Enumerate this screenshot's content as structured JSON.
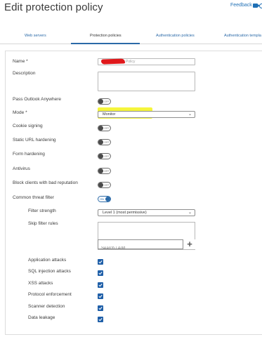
{
  "header": {
    "title": "Edit protection policy",
    "feedback": "Feedback",
    "icons": [
      "video-icon",
      "globe-icon"
    ]
  },
  "tabs": [
    {
      "label": "Web servers",
      "active": false
    },
    {
      "label": "Protection policies",
      "active": true
    },
    {
      "label": "Authentication policies",
      "active": false
    },
    {
      "label": "Authentication templa",
      "active": false
    }
  ],
  "form": {
    "name": {
      "label": "Name *",
      "value": "Policy",
      "redacted": true
    },
    "description": {
      "label": "Description",
      "value": ""
    },
    "pass_outlook_anywhere": {
      "label": "Pass Outlook Anywhere",
      "state": "OFF"
    },
    "mode": {
      "label": "Mode *",
      "value": "Monitor"
    },
    "cookie_signing": {
      "label": "Cookie signing",
      "state": "OFF"
    },
    "static_url_hardening": {
      "label": "Static URL hardening",
      "state": "OFF"
    },
    "form_hardening": {
      "label": "Form hardening",
      "state": "OFF"
    },
    "antivirus": {
      "label": "Antivirus",
      "state": "OFF"
    },
    "block_bad_reputation": {
      "label": "Block clients with bad reputation",
      "state": "OFF"
    },
    "common_threat_filter": {
      "label": "Common threat filter",
      "state": "ON"
    },
    "filter_strength": {
      "label": "Filter strength",
      "value": "Level 1 (most permissive)"
    },
    "skip_filter_rules": {
      "label": "Skip filter rules",
      "placeholder": "Search / Add"
    },
    "checks": [
      {
        "label": "Application attacks",
        "checked": true
      },
      {
        "label": "SQL injection attacks",
        "checked": true
      },
      {
        "label": "XSS attacks",
        "checked": true
      },
      {
        "label": "Protocol enforcement",
        "checked": true
      },
      {
        "label": "Scanner detection",
        "checked": true
      },
      {
        "label": "Data leakage",
        "checked": true
      }
    ]
  },
  "colors": {
    "accent": "#2b6aa8",
    "highlight": "#f3f31a",
    "redaction": "#e0181b"
  }
}
